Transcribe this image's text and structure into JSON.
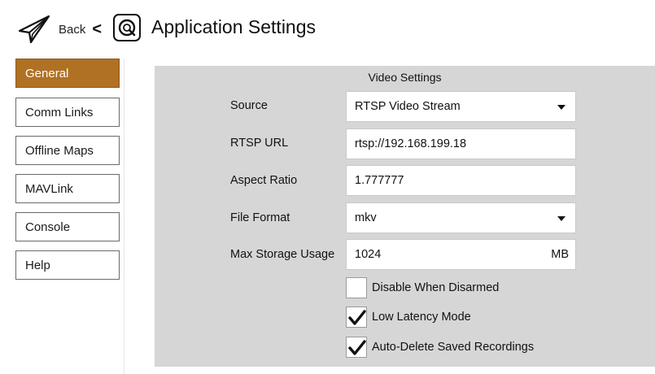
{
  "header": {
    "back_label": "Back",
    "back_chevron": "<",
    "title": "Application Settings",
    "icons": {
      "back": "paper-plane-icon",
      "logo": "qgc-logo-icon"
    }
  },
  "sidebar": {
    "items": [
      {
        "label": "General",
        "active": true
      },
      {
        "label": "Comm Links",
        "active": false
      },
      {
        "label": "Offline Maps",
        "active": false
      },
      {
        "label": "MAVLink",
        "active": false
      },
      {
        "label": "Console",
        "active": false
      },
      {
        "label": "Help",
        "active": false
      }
    ],
    "active_color": "#b07124"
  },
  "video": {
    "section_title": "Video Settings",
    "source": {
      "label": "Source",
      "value": "RTSP Video Stream"
    },
    "rtsp_url": {
      "label": "RTSP URL",
      "value": "rtsp://192.168.199.18"
    },
    "aspect_ratio": {
      "label": "Aspect Ratio",
      "value": "1.777777"
    },
    "file_format": {
      "label": "File Format",
      "value": "mkv"
    },
    "max_storage": {
      "label": "Max Storage Usage",
      "value": "1024",
      "unit": "MB"
    },
    "checks": [
      {
        "label": "Disable When Disarmed",
        "checked": false
      },
      {
        "label": "Low Latency Mode",
        "checked": true
      },
      {
        "label": "Auto-Delete Saved Recordings",
        "checked": true
      }
    ]
  }
}
